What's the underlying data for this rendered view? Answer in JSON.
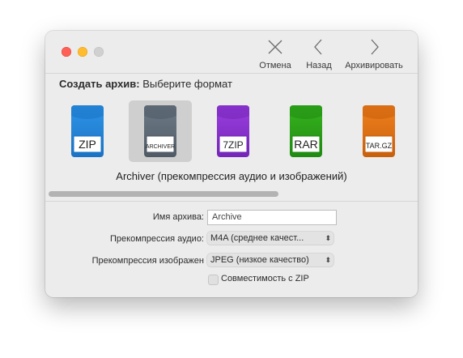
{
  "toolbar": {
    "cancel_label": "Отмена",
    "back_label": "Назад",
    "archive_label": "Архивировать"
  },
  "heading": {
    "bold": "Создать архив:",
    "text": "Выберите формат"
  },
  "formats": [
    {
      "label": "ZIP",
      "color": "#2f95e8",
      "dark": "#1a72c4",
      "selected": false
    },
    {
      "label": "ARCHIVER",
      "color": "#6f7b88",
      "dark": "#4f5a66",
      "selected": true
    },
    {
      "label": "7ZIP",
      "color": "#9b3fe0",
      "dark": "#7426b8",
      "selected": false
    },
    {
      "label": "RAR",
      "color": "#38b51f",
      "dark": "#1f8a12",
      "selected": false
    },
    {
      "label": "TAR.GZ",
      "color": "#f0821e",
      "dark": "#c85f0c",
      "selected": false
    }
  ],
  "caption": "Archiver (прекомпрессия аудио и изображений)",
  "form": {
    "archive_name_label": "Имя архива:",
    "archive_name_value": "Archive",
    "audio_label": "Прекомпрессия аудио:",
    "audio_value": "M4A (среднее качест...",
    "image_label": "Прекомпрессия изображен",
    "image_value": "JPEG (низкое качество)",
    "zip_compat_label": "Совместимость с ZIP",
    "zip_compat_checked": false
  }
}
